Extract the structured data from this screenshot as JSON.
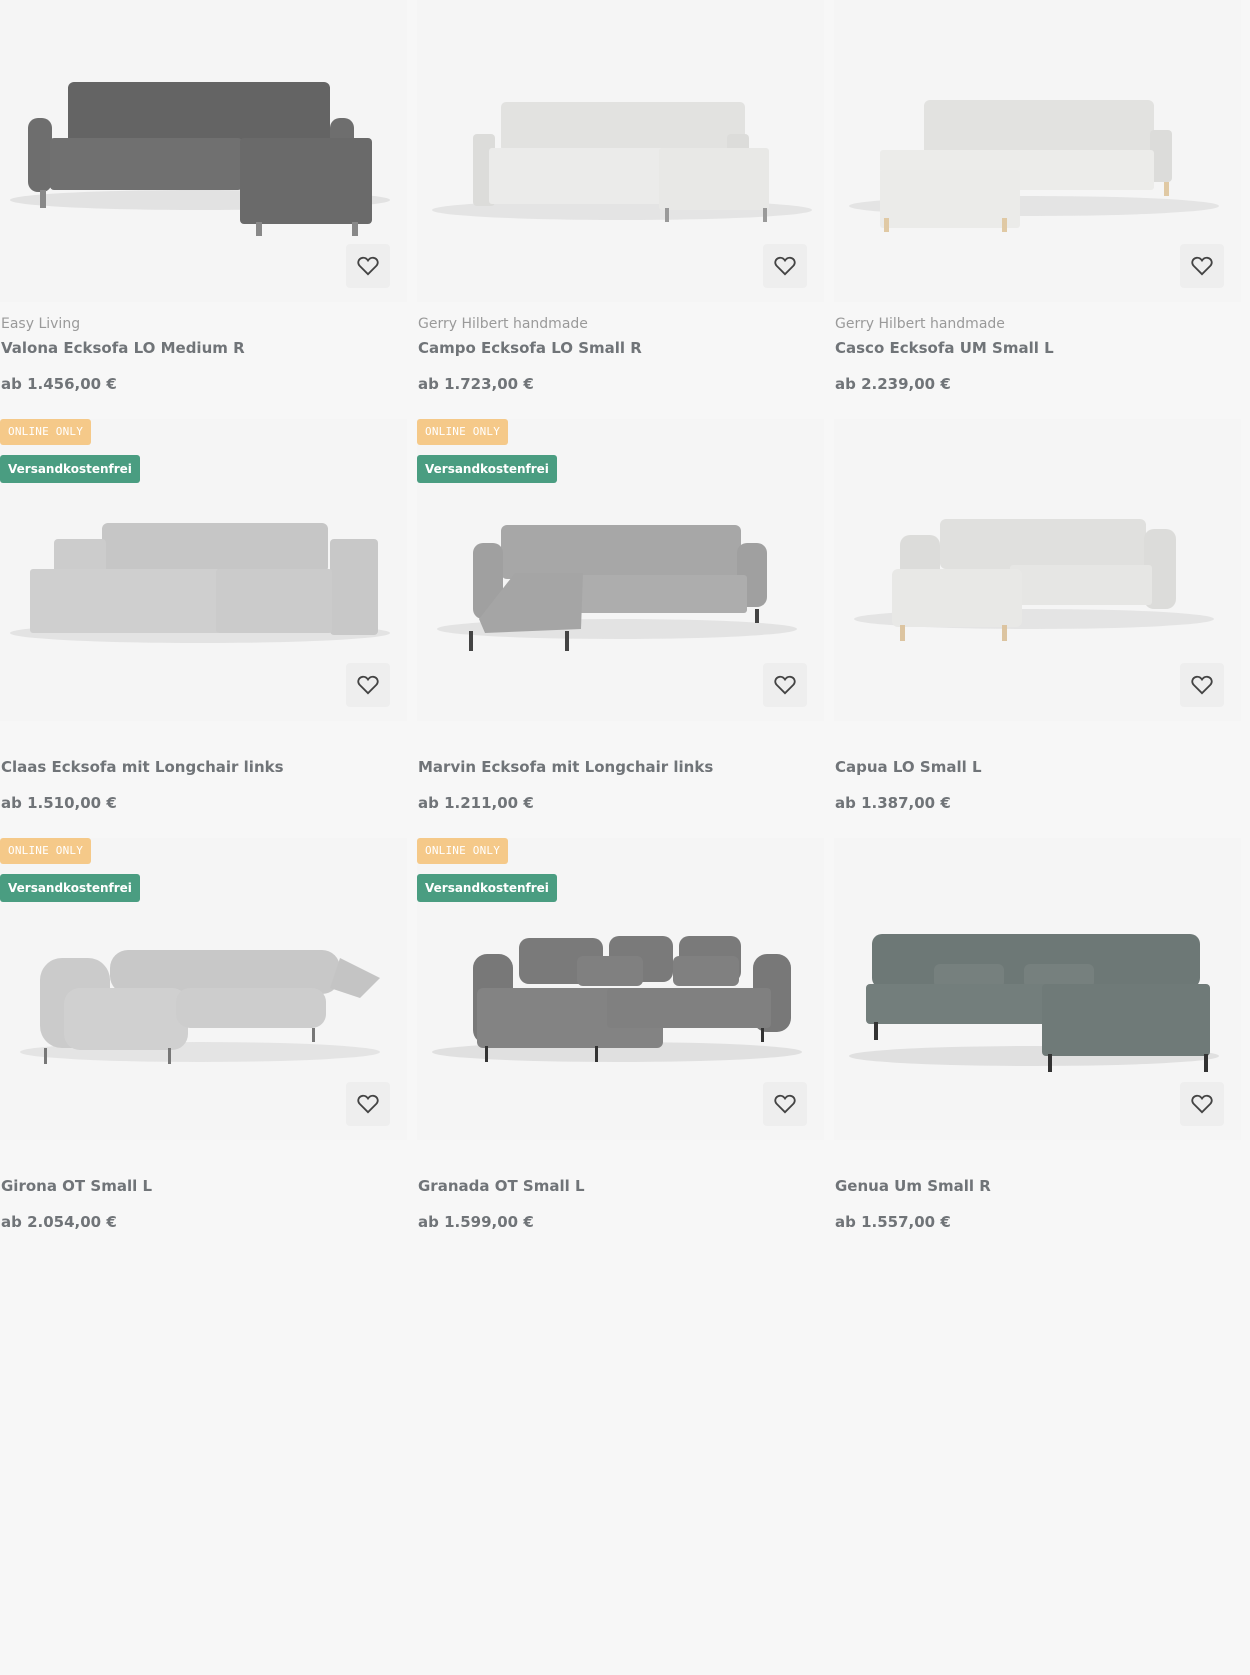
{
  "badges": {
    "online_only": "ONLINE ONLY",
    "free_shipping": "Versandkostenfrei"
  },
  "products": [
    {
      "brand": "Easy Living",
      "name": "Valona Ecksofa LO Medium R",
      "price": "ab 1.456,00 €",
      "color": "#6b6b6b",
      "online_only": false,
      "free_shipping": false
    },
    {
      "brand": "Gerry Hilbert handmade",
      "name": "Campo Ecksofa LO Small R",
      "price": "ab 1.723,00 €",
      "color": "#e6e6e4",
      "online_only": false,
      "free_shipping": false
    },
    {
      "brand": "Gerry Hilbert handmade",
      "name": "Casco Ecksofa UM Small L",
      "price": "ab 2.239,00 €",
      "color": "#e8e8e6",
      "online_only": false,
      "free_shipping": false
    },
    {
      "brand": "",
      "name": "Claas Ecksofa mit Longchair links",
      "price": "ab 1.510,00 €",
      "color": "#c7c7c7",
      "online_only": true,
      "free_shipping": true
    },
    {
      "brand": "",
      "name": "Marvin Ecksofa mit Longchair links",
      "price": "ab 1.211,00 €",
      "color": "#a3a3a3",
      "online_only": true,
      "free_shipping": true
    },
    {
      "brand": "",
      "name": "Capua LO Small L",
      "price": "ab 1.387,00 €",
      "color": "#e4e4e2",
      "online_only": false,
      "free_shipping": false
    },
    {
      "brand": "",
      "name": "Girona OT Small L",
      "price": "ab 2.054,00 €",
      "color": "#c9c9c9",
      "online_only": true,
      "free_shipping": true
    },
    {
      "brand": "",
      "name": "Granada OT Small L",
      "price": "ab 1.599,00 €",
      "color": "#7d7d7d",
      "online_only": true,
      "free_shipping": true
    },
    {
      "brand": "",
      "name": "Genua Um Small R",
      "price": "ab 1.557,00 €",
      "color": "#6f7a78",
      "online_only": false,
      "free_shipping": false
    }
  ]
}
